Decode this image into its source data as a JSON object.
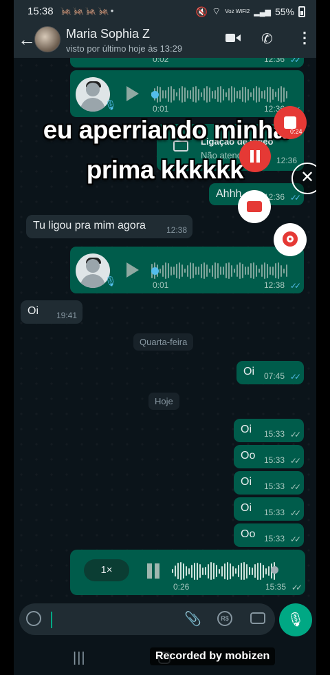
{
  "status_bar": {
    "time": "15:38",
    "notifications": "🦗🦗🦗🦗•",
    "volte": "Voz WiFi2",
    "battery": "55%"
  },
  "header": {
    "contact_name": "Maria Sophia Z",
    "last_seen": "visto por último hoje às 13:29"
  },
  "messages": {
    "v0_time": "12:36",
    "v0_dur": "0:02",
    "v1_time": "12:36",
    "v1_dur": "0:01",
    "call_title": "Ligação de vídeo",
    "call_sub": "Não atendida",
    "call_time": "12:36",
    "m_ahhh": "Ahhh",
    "m_ahhh_time": "12:36",
    "m_ligou": "Tu ligou pra mim agora",
    "m_ligou_time": "12:38",
    "v2_time": "12:38",
    "v2_dur": "0:01",
    "m_oi1": "Oi",
    "m_oi1_time": "19:41",
    "day1": "Quarta-feira",
    "m_oi2": "Oi",
    "m_oi2_time": "07:45",
    "day2": "Hoje",
    "m_a": "Oi",
    "m_a_time": "15:33",
    "m_b": "Oo",
    "m_b_time": "15:33",
    "m_c": "Oi",
    "m_c_time": "15:33",
    "m_d": "Oi",
    "m_d_time": "15:33",
    "m_e": "Oo",
    "m_e_time": "15:33"
  },
  "caption": {
    "line1": "eu aperriando minha",
    "line2": "prima kkkkkk"
  },
  "recorder": {
    "elapsed": "0:24",
    "close": "✕"
  },
  "recording_bar": {
    "speed": "1×",
    "duration": "0:26",
    "time": "15:35"
  },
  "input": {
    "rs_label": "R$"
  },
  "watermark": "Recorded by mobizen",
  "colors": {
    "outgoing": "#005c4b",
    "incoming": "#202c33",
    "accent": "#00a884",
    "read_ticks": "#53bdeb"
  }
}
